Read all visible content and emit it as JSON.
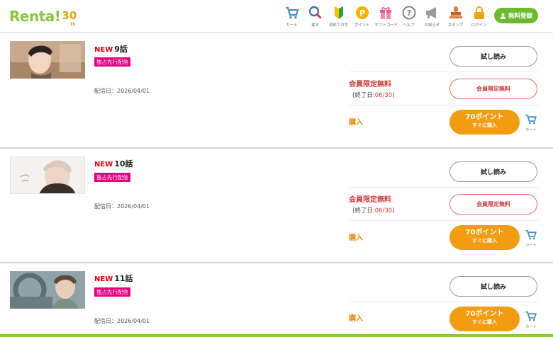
{
  "header": {
    "logo_text": "Renta!",
    "logo_number": "30",
    "logo_suffix": "th",
    "nav": [
      {
        "label": "カート",
        "icon": "cart-icon"
      },
      {
        "label": "探す",
        "icon": "search-icon"
      },
      {
        "label": "初めての方",
        "icon": "beginner-mark-icon"
      },
      {
        "label": "ポイント",
        "icon": "point-coin-icon"
      },
      {
        "label": "ギフトコード",
        "icon": "gift-icon"
      },
      {
        "label": "ヘルプ",
        "icon": "help-icon"
      },
      {
        "label": "お知らせ",
        "icon": "megaphone-icon"
      },
      {
        "label": "スタンプ",
        "icon": "stamp-icon"
      },
      {
        "label": "ログイン",
        "icon": "lock-icon"
      }
    ],
    "register_label": "無料登録"
  },
  "episodes": [
    {
      "new_tag": "NEW",
      "title": "9話",
      "badge": "独占先行配信",
      "date": "配信日：2026/04/01",
      "trial_label": "試し読み",
      "free_label": "会員限定無料",
      "end_prefix": "(終了日:",
      "end_date": "06/30",
      "end_suffix": ")",
      "free_button_label": "会員限定無料",
      "buy_label": "購入",
      "buy_points": "70ポイント",
      "buy_now": "すぐに購入",
      "cart_label": "カート"
    },
    {
      "new_tag": "NEW",
      "title": "10話",
      "badge": "独占先行配信",
      "date": "配信日：2026/04/01",
      "trial_label": "試し読み",
      "free_label": "会員限定無料",
      "end_prefix": "(終了日:",
      "end_date": "06/30",
      "end_suffix": ")",
      "free_button_label": "会員限定無料",
      "buy_label": "購入",
      "buy_points": "70ポイント",
      "buy_now": "すぐに購入",
      "cart_label": "カート"
    },
    {
      "new_tag": "NEW",
      "title": "11話",
      "badge": "独占先行配信",
      "date": "配信日：2026/04/01",
      "trial_label": "試し読み",
      "buy_label": "購入",
      "buy_points": "70ポイント",
      "buy_now": "すぐに購入",
      "cart_label": "カート"
    }
  ],
  "colors": {
    "brand_green": "#8cc63f",
    "register_green": "#6cba2d",
    "buy_orange": "#f39c12",
    "free_red": "#d03a3a",
    "badge_pink": "#e4007f",
    "new_red": "#e50012"
  }
}
